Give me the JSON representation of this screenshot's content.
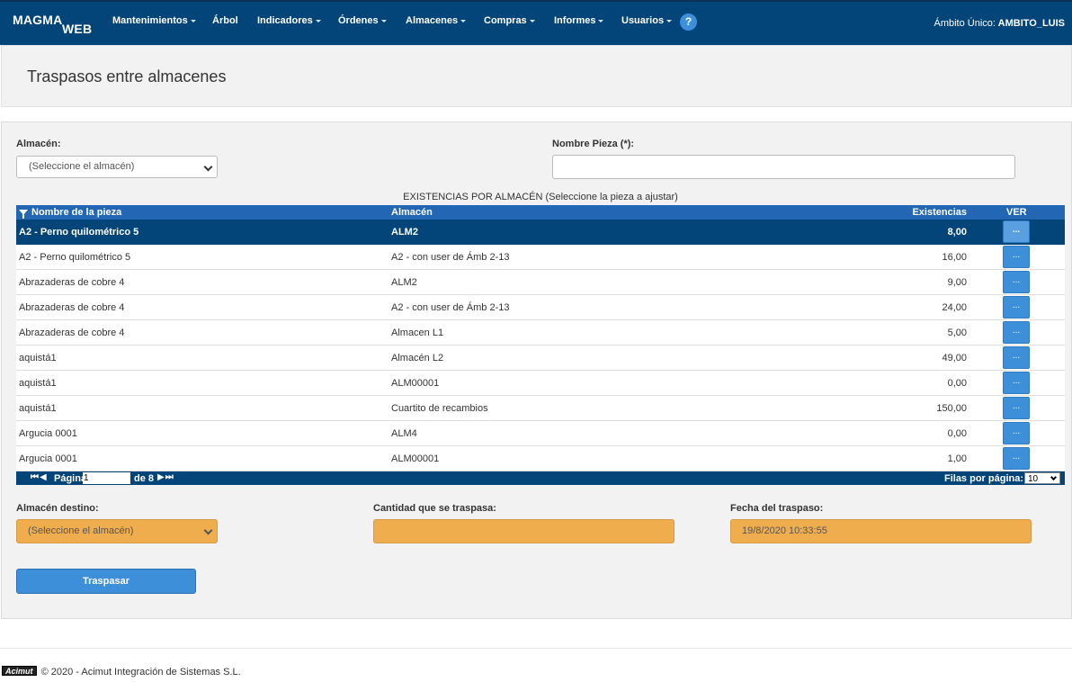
{
  "navbar": {
    "logo_main": "MAGMA",
    "logo_sub": "WEB",
    "menu": [
      {
        "label": "Mantenimientos",
        "dropdown": true
      },
      {
        "label": "Árbol",
        "dropdown": false
      },
      {
        "label": "Indicadores",
        "dropdown": true
      },
      {
        "label": "Órdenes",
        "dropdown": true
      },
      {
        "label": "Almacenes",
        "dropdown": true
      },
      {
        "label": "Compras",
        "dropdown": true
      },
      {
        "label": "Informes",
        "dropdown": true
      },
      {
        "label": "Usuarios",
        "dropdown": true
      }
    ],
    "help_icon": "?",
    "ambito_label": "Ámbito Único:",
    "ambito_value": "AMBITO_LUIS"
  },
  "page": {
    "title": "Traspasos entre almacenes"
  },
  "filters": {
    "almacen_label": "Almacén:",
    "almacen_value": "(Seleccione el almacén)",
    "pieza_label": "Nombre Pieza (*):",
    "pieza_value": ""
  },
  "grid": {
    "caption": "EXISTENCIAS POR ALMACÉN (Seleccione la pieza a ajustar)",
    "headers": {
      "name": "Nombre de la pieza",
      "almacen": "Almacén",
      "existencias": "Existencias",
      "ver": "VER"
    },
    "ver_button_label": "...",
    "rows": [
      {
        "name": "A2 - Perno quilométrico 5",
        "almacen": "ALM2",
        "existencias": "8,00",
        "selected": true
      },
      {
        "name": "A2 - Perno quilométrico 5",
        "almacen": "A2 - con user de Ámb 2-13",
        "existencias": "16,00",
        "selected": false
      },
      {
        "name": "Abrazaderas de cobre 4",
        "almacen": "ALM2",
        "existencias": "9,00",
        "selected": false
      },
      {
        "name": "Abrazaderas de cobre 4",
        "almacen": "A2 - con user de Ámb 2-13",
        "existencias": "24,00",
        "selected": false
      },
      {
        "name": "Abrazaderas de cobre 4",
        "almacen": "Almacen L1",
        "existencias": "5,00",
        "selected": false
      },
      {
        "name": "aquistá1",
        "almacen": "Almacén L2",
        "existencias": "49,00",
        "selected": false
      },
      {
        "name": "aquistá1",
        "almacen": "ALM00001",
        "existencias": "0,00",
        "selected": false
      },
      {
        "name": "aquistá1",
        "almacen": "Cuartito de recambios",
        "existencias": "150,00",
        "selected": false
      },
      {
        "name": "Argucia 0001",
        "almacen": "ALM4",
        "existencias": "0,00",
        "selected": false
      },
      {
        "name": "Argucia 0001",
        "almacen": "ALM00001",
        "existencias": "1,00",
        "selected": false
      }
    ],
    "pager": {
      "page_label": "Página",
      "page_value": "1",
      "of_label": "de 8",
      "rows_label": "Filas por página:",
      "rows_value": "10"
    }
  },
  "transfer": {
    "destino_label": "Almacén destino:",
    "destino_value": "(Seleccione el almacén)",
    "cantidad_label": "Cantidad que se traspasa:",
    "cantidad_value": "",
    "fecha_label": "Fecha del traspaso:",
    "fecha_value": "19/8/2020 10:33:55",
    "submit_label": "Traspasar"
  },
  "footer": {
    "badge": "Acimut",
    "text": "© 2020 - Acimut Integración de Sistemas S.L."
  },
  "colors": {
    "navbar": "#034479",
    "grid_header": "#2266b4",
    "button": "#3e8fd9",
    "required_field": "#f0ad4e"
  }
}
